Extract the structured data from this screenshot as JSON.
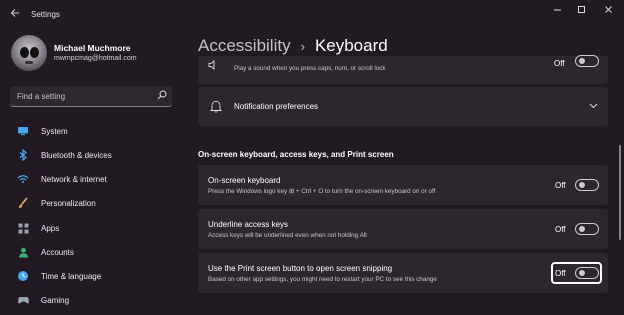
{
  "window": {
    "title": "Settings"
  },
  "user": {
    "name": "Michael Muchmore",
    "email": "mwmpcmag@hotmail.com"
  },
  "search": {
    "placeholder": "Find a setting"
  },
  "nav": {
    "items": [
      {
        "label": "System",
        "icon": "monitor-icon"
      },
      {
        "label": "Bluetooth & devices",
        "icon": "bluetooth-icon"
      },
      {
        "label": "Network & internet",
        "icon": "wifi-icon"
      },
      {
        "label": "Personalization",
        "icon": "brush-icon"
      },
      {
        "label": "Apps",
        "icon": "apps-icon"
      },
      {
        "label": "Accounts",
        "icon": "person-icon"
      },
      {
        "label": "Time & language",
        "icon": "globe-clock-icon"
      },
      {
        "label": "Gaming",
        "icon": "gamepad-icon"
      }
    ]
  },
  "breadcrumb": {
    "parent": "Accessibility",
    "separator": "›",
    "current": "Keyboard"
  },
  "partial_card": {
    "description": "Play a sound when you press caps, num, or scroll lock",
    "state": "Off"
  },
  "notification_card": {
    "title": "Notification preferences"
  },
  "section": {
    "title": "On-screen keyboard, access keys, and Print screen"
  },
  "settings": [
    {
      "title": "On-screen keyboard",
      "description": "Press the Windows logo key ⊞ + Ctrl + O to turn the on-screen keyboard on or off",
      "state": "Off"
    },
    {
      "title": "Underline access keys",
      "description": "Access keys will be underlined even when not holding Alt",
      "state": "Off"
    },
    {
      "title": "Use the Print screen button to open screen snipping",
      "description": "Based on other app settings, you might need to restart your PC to see this change",
      "state": "Off"
    }
  ],
  "colors": {
    "background": "#221a22",
    "card": "#2d262d",
    "accent_blue": "#4aa8f0"
  }
}
